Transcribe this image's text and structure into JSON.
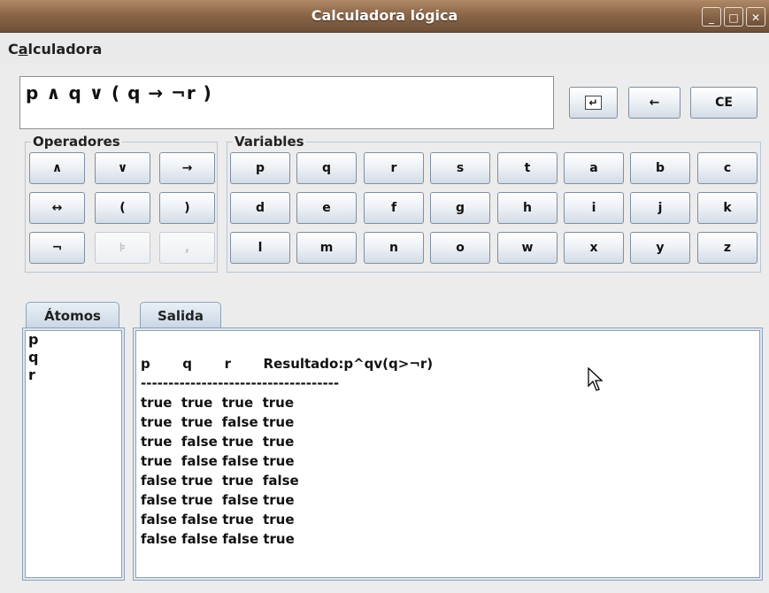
{
  "window": {
    "title": "Calculadora lógica",
    "minimize": "_",
    "maximize": "□",
    "close": "✕"
  },
  "menubar": {
    "menu_pre": "C",
    "menu_mnemonic": "a",
    "menu_post": "lculadora"
  },
  "expression": {
    "value": "p ∧ q ∨ ( q → ¬r )"
  },
  "actions": {
    "enter": "↵",
    "backspace": "←",
    "clear": "CE"
  },
  "operators": {
    "legend": "Operadores",
    "rows": [
      [
        "∧",
        "∨",
        "→"
      ],
      [
        "↔",
        "(",
        ")"
      ],
      [
        "¬",
        "⊧",
        ","
      ]
    ],
    "disabled": [
      "⊧",
      ","
    ]
  },
  "variables": {
    "legend": "Variables",
    "rows": [
      [
        "p",
        "q",
        "r",
        "s",
        "t",
        "a",
        "b",
        "c"
      ],
      [
        "d",
        "e",
        "f",
        "g",
        "h",
        "i",
        "j",
        "k"
      ],
      [
        "l",
        "m",
        "n",
        "o",
        "w",
        "x",
        "y",
        "z"
      ]
    ]
  },
  "atoms": {
    "tab_label": "Átomos",
    "items": [
      "p",
      "q",
      "r"
    ]
  },
  "output": {
    "tab_label": "Salida",
    "lines": [
      "p       q       r       Resultado:p^qv(q>¬r)",
      "------------------------------------",
      "true  true  true  true",
      "true  true  false true",
      "true  false true  true",
      "true  false false true",
      "false true  true  false",
      "false true  false true",
      "false false true  true",
      "false false false true"
    ]
  }
}
